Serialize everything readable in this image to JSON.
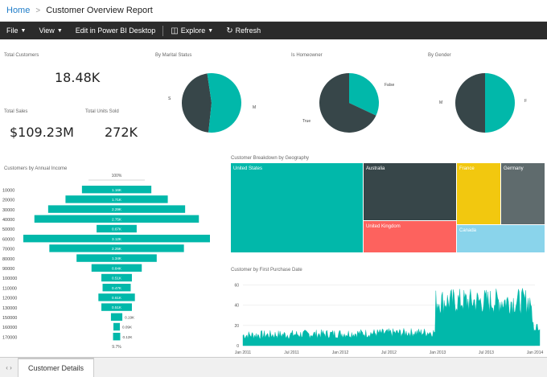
{
  "breadcrumb": {
    "home": "Home",
    "separator": ">",
    "report": "Customer Overview Report"
  },
  "toolbar": {
    "file": "File",
    "view": "View",
    "edit_desktop": "Edit in Power BI Desktop",
    "explore": "Explore",
    "refresh": "Refresh"
  },
  "kpis": {
    "total_customers": {
      "title": "Total Customers",
      "value": "18.48K"
    },
    "total_sales": {
      "title": "Total Sales",
      "value": "$109.23M"
    },
    "total_units": {
      "title": "Total Units Sold",
      "value": "272K"
    }
  },
  "pies": {
    "marital": {
      "title": "By Marital Status",
      "labels": [
        "S",
        "M"
      ]
    },
    "homeowner": {
      "title": "Is Homeowner",
      "labels": [
        "False",
        "True"
      ]
    },
    "gender": {
      "title": "By Gender",
      "labels": [
        "M",
        "F"
      ]
    }
  },
  "funnel": {
    "title": "Customers by Annual Income",
    "top_label": "100%",
    "bottom_label": "9.7%"
  },
  "treemap": {
    "title": "Customer Breakdown by Geography"
  },
  "area": {
    "title": "Customer by First Purchase Date"
  },
  "tabs": {
    "active": "Customer Details"
  },
  "colors": {
    "teal": "#01b8aa",
    "dark": "#374649",
    "red": "#fd625e",
    "yellow": "#f2c80f",
    "gray": "#5f6b6d",
    "lightblue": "#8ad4eb"
  },
  "chart_data": [
    {
      "type": "pie",
      "title": "By Marital Status",
      "categories": [
        "S",
        "M"
      ],
      "values": [
        46,
        54
      ]
    },
    {
      "type": "pie",
      "title": "Is Homeowner",
      "categories": [
        "False",
        "True"
      ],
      "values": [
        32,
        68
      ]
    },
    {
      "type": "pie",
      "title": "By Gender",
      "categories": [
        "M",
        "F"
      ],
      "values": [
        50,
        50
      ]
    },
    {
      "type": "bar",
      "orientation": "funnel",
      "title": "Customers by Annual Income",
      "categories": [
        "10000",
        "20000",
        "30000",
        "40000",
        "50000",
        "60000",
        "70000",
        "80000",
        "90000",
        "100000",
        "110000",
        "120000",
        "130000",
        "150000",
        "160000",
        "170000"
      ],
      "value_labels": [
        "1.16K",
        "1.71K",
        "2.29K",
        "2.75K",
        "0.67K",
        "3.12K",
        "2.25K",
        "1.34K",
        "0.84K",
        "0.51K",
        "0.47K",
        "0.61K",
        "0.51K",
        "0.19K",
        "0.09K",
        "0.12K"
      ],
      "values": [
        1.16,
        1.71,
        2.29,
        2.75,
        0.67,
        3.12,
        2.25,
        1.34,
        0.84,
        0.51,
        0.47,
        0.61,
        0.51,
        0.19,
        0.09,
        0.12
      ]
    },
    {
      "type": "heatmap",
      "title": "Customer Breakdown by Geography",
      "categories": [
        "United States",
        "Australia",
        "United Kingdom",
        "France",
        "Germany",
        "Canada"
      ]
    },
    {
      "type": "area",
      "title": "Customer by First Purchase Date",
      "x_ticks": [
        "Jan 2011",
        "Jul 2011",
        "Jan 2012",
        "Jul 2012",
        "Jan 2013",
        "Jul 2013",
        "Jan 2014"
      ],
      "y_ticks": [
        0,
        20,
        40,
        60
      ],
      "ylim": [
        0,
        62
      ],
      "segments": [
        {
          "from": "Jan 2011",
          "to": "Jan 2013",
          "approx_value": 12
        },
        {
          "from": "Jan 2013",
          "to": "Jan 2014",
          "approx_value": 42
        }
      ]
    }
  ]
}
